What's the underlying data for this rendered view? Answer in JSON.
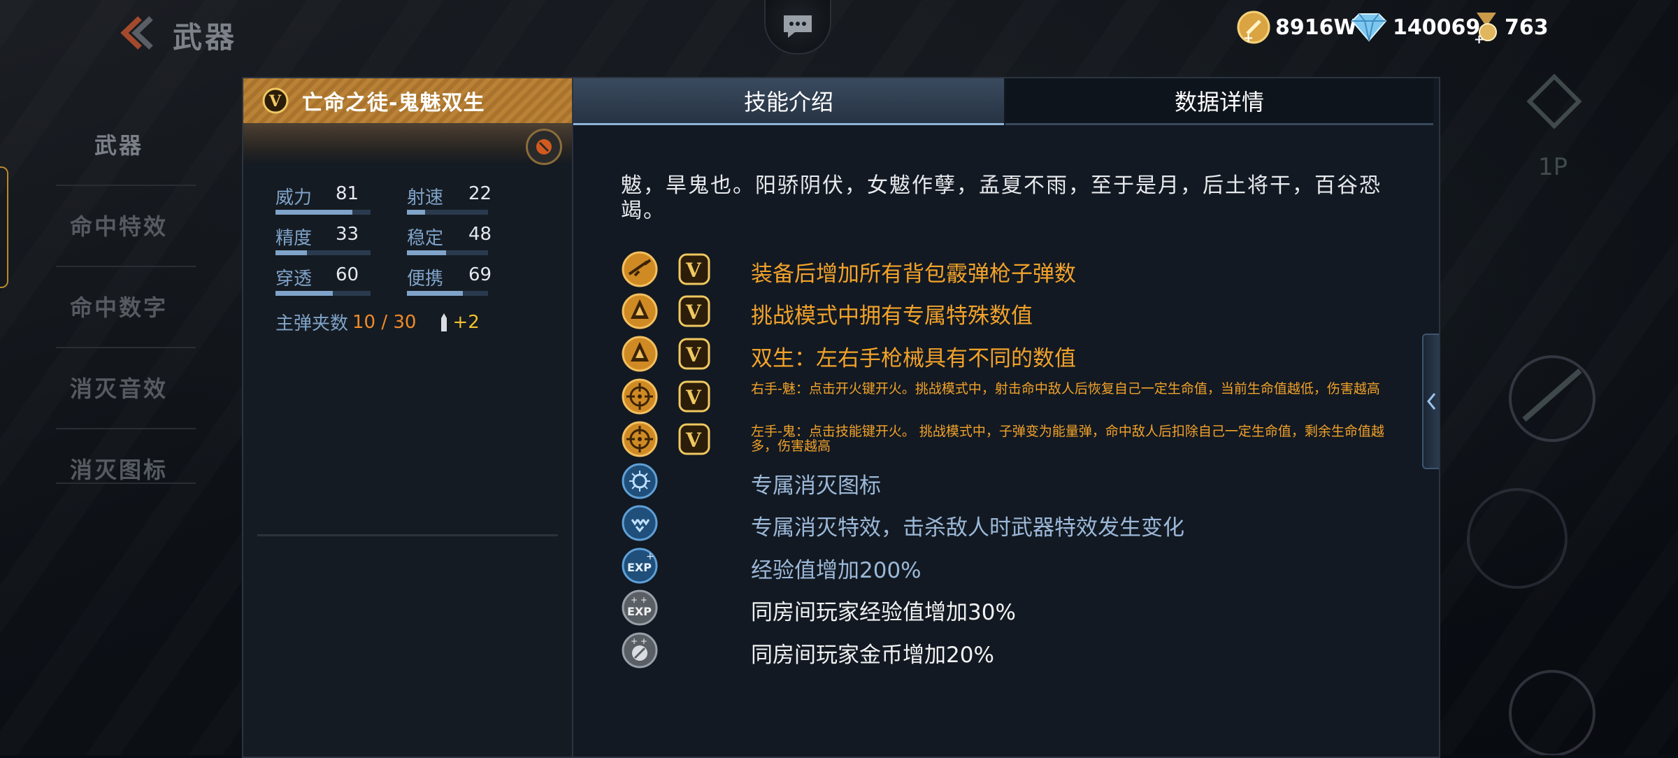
{
  "header": {
    "title": "武器"
  },
  "currencies": [
    {
      "icon": "gold-coin-icon",
      "value": "8916W"
    },
    {
      "icon": "diamond-icon",
      "value": "140069"
    },
    {
      "icon": "medal-icon",
      "value": "763"
    }
  ],
  "sidebar": {
    "items": [
      {
        "label": "武器"
      },
      {
        "label": "命中特效"
      },
      {
        "label": "命中数字"
      },
      {
        "label": "消灭音效"
      },
      {
        "label": "消灭图标"
      }
    ]
  },
  "weapon": {
    "name": "亡命之徒-鬼魅双生",
    "stats": [
      {
        "label": "威力",
        "value": "81",
        "level": 0.81
      },
      {
        "label": "射速",
        "value": "22",
        "level": 0.22
      },
      {
        "label": "精度",
        "value": "33",
        "level": 0.33
      },
      {
        "label": "稳定",
        "value": "48",
        "level": 0.48
      },
      {
        "label": "穿透",
        "value": "60",
        "level": 0.6
      },
      {
        "label": "便携",
        "value": "69",
        "level": 0.69
      }
    ],
    "ammo_label": "主弹夹数",
    "ammo_value": "10 / 30",
    "ammo_bonus": "+2"
  },
  "tabs": {
    "skill": "技能介绍",
    "data": "数据详情"
  },
  "description": "魃，旱鬼也。阳骄阴伏，女魃作孽，孟夏不雨，至于是月，后土将干，百谷恐竭。",
  "features": [
    {
      "icon": "rifle-badge-icon",
      "has_v": true,
      "color": "gold",
      "text": "装备后增加所有背包霰弹枪子弹数"
    },
    {
      "icon": "challenge-mode-icon",
      "has_v": true,
      "color": "gold",
      "text": "挑战模式中拥有专属特殊数值"
    },
    {
      "icon": "challenge-mode-icon",
      "has_v": true,
      "color": "gold",
      "text": "双生：左右手枪械具有不同的数值"
    },
    {
      "icon": "crosshair-icon",
      "has_v": true,
      "color": "gold",
      "small": true,
      "text": "右手-魅：点击开火键开火。挑战模式中，射击命中敌人后恢复自己一定生命值，当前生命值越低，伤害越高"
    },
    {
      "icon": "crosshair-icon",
      "has_v": true,
      "color": "gold",
      "small": true,
      "text": "左手-鬼：点击技能键开火。 挑战模式中，子弹变为能量弹，命中敌人后扣除自己一定生命值，剩余生命值越多，伤害越高"
    },
    {
      "icon": "kill-icon-badge",
      "has_v": false,
      "color": "blue",
      "text": "专属消灭图标"
    },
    {
      "icon": "kill-effect-badge",
      "has_v": false,
      "color": "blue",
      "text": "专属消灭特效，击杀敌人时武器特效发生变化"
    },
    {
      "icon": "exp-badge-icon",
      "has_v": false,
      "color": "blue",
      "text": "经验值增加200%"
    },
    {
      "icon": "room-exp-badge-icon",
      "has_v": false,
      "color": "white",
      "text": "同房间玩家经验值增加30%"
    },
    {
      "icon": "room-coin-badge-icon",
      "has_v": false,
      "color": "white",
      "text": "同房间玩家金币增加20%"
    }
  ],
  "colors": {
    "gold": "#f2a22a",
    "blue_text": "#9cb8d8",
    "ammo": "#f08a2a",
    "accent_bar": "#7fa3c9"
  }
}
